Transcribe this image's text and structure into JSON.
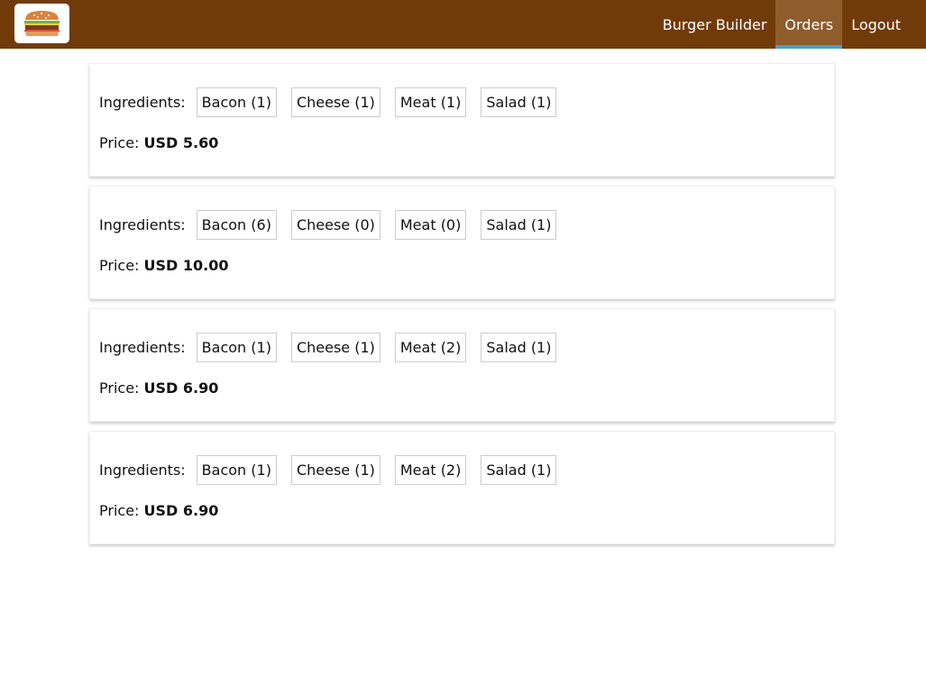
{
  "toolbar": {
    "logo_icon": "burger-logo-icon",
    "nav": [
      {
        "label": "Burger Builder",
        "active": false
      },
      {
        "label": "Orders",
        "active": true
      },
      {
        "label": "Logout",
        "active": false
      }
    ],
    "colors": {
      "background": "#703B09",
      "active_bg": "#8F5C2C",
      "active_border": "#40A4C8"
    }
  },
  "orders": [
    {
      "ingredients_label": "Ingredients:",
      "ingredients": [
        "Bacon (1)",
        "Cheese (1)",
        "Meat (1)",
        "Salad (1)"
      ],
      "price_label": "Price:",
      "price": "USD 5.60"
    },
    {
      "ingredients_label": "Ingredients:",
      "ingredients": [
        "Bacon (6)",
        "Cheese (0)",
        "Meat (0)",
        "Salad (1)"
      ],
      "price_label": "Price:",
      "price": "USD 10.00"
    },
    {
      "ingredients_label": "Ingredients:",
      "ingredients": [
        "Bacon (1)",
        "Cheese (1)",
        "Meat (2)",
        "Salad (1)"
      ],
      "price_label": "Price:",
      "price": "USD 6.90"
    },
    {
      "ingredients_label": "Ingredients:",
      "ingredients": [
        "Bacon (1)",
        "Cheese (1)",
        "Meat (2)",
        "Salad (1)"
      ],
      "price_label": "Price:",
      "price": "USD 6.90"
    }
  ]
}
